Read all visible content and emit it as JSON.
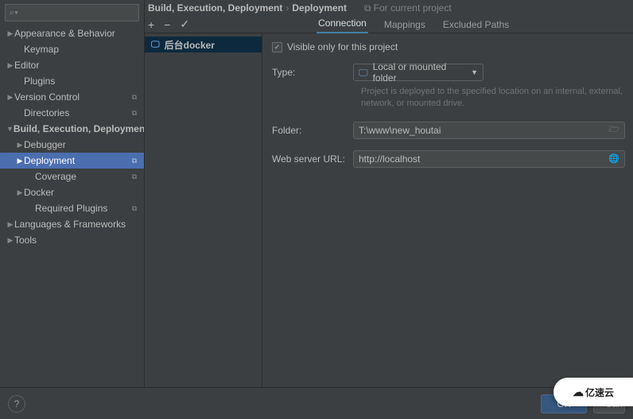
{
  "breadcrumb": {
    "root": "Build, Execution, Deployment",
    "leaf": "Deployment",
    "scope_label": "For current project"
  },
  "sidebar": {
    "items": [
      {
        "label": "Appearance & Behavior",
        "arrow": "closed",
        "indent": 1,
        "indicator": ""
      },
      {
        "label": "Keymap",
        "arrow": "none",
        "indent": 2,
        "indicator": ""
      },
      {
        "label": "Editor",
        "arrow": "closed",
        "indent": 1,
        "indicator": ""
      },
      {
        "label": "Plugins",
        "arrow": "none",
        "indent": 2,
        "indicator": ""
      },
      {
        "label": "Version Control",
        "arrow": "closed",
        "indent": 1,
        "indicator": "⧉"
      },
      {
        "label": "Directories",
        "arrow": "none",
        "indent": 2,
        "indicator": "⧉"
      },
      {
        "label": "Build, Execution, Deployment",
        "arrow": "open",
        "indent": 1,
        "bold": true,
        "indicator": ""
      },
      {
        "label": "Debugger",
        "arrow": "closed",
        "indent": 2,
        "indicator": ""
      },
      {
        "label": "Deployment",
        "arrow": "closed",
        "indent": 2,
        "selected": true,
        "indicator": "⧉"
      },
      {
        "label": "Coverage",
        "arrow": "none",
        "indent": 3,
        "indicator": "⧉"
      },
      {
        "label": "Docker",
        "arrow": "closed",
        "indent": 2,
        "indicator": ""
      },
      {
        "label": "Required Plugins",
        "arrow": "none",
        "indent": 3,
        "indicator": "⧉"
      },
      {
        "label": "Languages & Frameworks",
        "arrow": "closed",
        "indent": 1,
        "indicator": ""
      },
      {
        "label": "Tools",
        "arrow": "closed",
        "indent": 1,
        "indicator": ""
      }
    ]
  },
  "tabs": [
    {
      "label": "Connection",
      "active": true
    },
    {
      "label": "Mappings",
      "active": false
    },
    {
      "label": "Excluded Paths",
      "active": false
    }
  ],
  "server": {
    "name": "后台docker"
  },
  "form": {
    "visible_only_label": "Visible only for this project",
    "visible_only": true,
    "type_label": "Type:",
    "type_value": "Local or mounted folder",
    "type_hint": "Project is deployed to the specified location on an internal, external, network, or mounted drive.",
    "folder_label": "Folder:",
    "folder_value": "T:\\www\\new_houtai",
    "url_label": "Web server URL:",
    "url_value": "http://localhost"
  },
  "footer": {
    "ok": "OK",
    "cancel": "Cancel",
    "help": "?"
  },
  "brand": "亿速云"
}
